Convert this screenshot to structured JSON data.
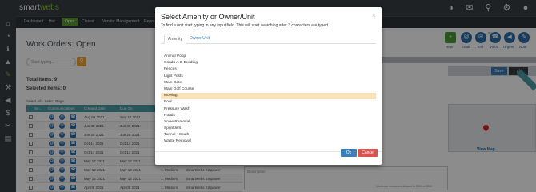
{
  "app": {
    "brand_main": "smart",
    "brand_accent": "webs"
  },
  "nav": {
    "tabs": [
      "Dashboard",
      "Hot",
      "Open",
      "Closed",
      "Vendor Management",
      "Reports"
    ],
    "active": "Open"
  },
  "page": {
    "title": "Work Orders: Open",
    "search_placeholder": "Start typing...",
    "total_items": "Total Items: 9",
    "selected_items": "Selected Items: 0",
    "select_links": "Select All · Select Page"
  },
  "table": {
    "columns": [
      "Se...",
      "Communications",
      "Created Date",
      "Due On"
    ],
    "rows": [
      {
        "created": "Aug 06 2021",
        "due": "Sep 10 2021",
        "priority": "",
        "vendor": ""
      },
      {
        "created": "Jun 30 2021",
        "due": "Jun 30 2021",
        "priority": "",
        "vendor": ""
      },
      {
        "created": "Jun 25 2021",
        "due": "Jun 25 2021",
        "priority": "",
        "vendor": ""
      },
      {
        "created": "Oct 14 2021",
        "due": "Oct 14 2021",
        "priority": "",
        "vendor": ""
      },
      {
        "created": "Oct 14 2021",
        "due": "Oct 14 2021",
        "priority": "",
        "vendor": ""
      },
      {
        "created": "May 12 2021",
        "due": "May 12 2021",
        "priority": "1. Medium",
        "vendor": "Smartwebs Empower"
      },
      {
        "created": "May 12 2021",
        "due": "May 12 2021",
        "priority": "1. Medium",
        "vendor": "Smartwebs Empower"
      },
      {
        "created": "May 12 2021",
        "due": "May 12 2021",
        "priority": "1. Medium",
        "vendor": "Smartwebs Empower"
      },
      {
        "created": "Apr 08 2021",
        "due": "Apr 08 2021",
        "priority": "1. Medium",
        "vendor": "Smartwebs Empower"
      }
    ]
  },
  "right_panel": {
    "sort_label": "Sort",
    "buttons": [
      "New",
      "Email",
      "Text",
      "Voice",
      "Urgent",
      "Note"
    ],
    "save": "Save",
    "view_map": "View Map",
    "description_label": "Description",
    "max_chars": "Maximum characters allowed is 2500 of 2500"
  },
  "modal": {
    "title": "Select Amenity or Owner/Unit",
    "hint": "To find a unit start typing in any input field. This will start searching after 3 characters are typed.",
    "tabs": [
      "Amenity",
      "Owner/Unit"
    ],
    "active_tab": "Amenity",
    "items": [
      "Animal Poop",
      "Condo A-D Building",
      "Fences",
      "Light Posts",
      "Main Gate",
      "Main Golf Course",
      "Mowing",
      "Pool",
      "Pressure Wash",
      "Roads",
      "Snow Removal",
      "Sprinklers",
      "Tunnel - South",
      "Waste Removal"
    ],
    "selected_item": "Mowing",
    "ok": "Ok",
    "cancel": "Cancel"
  },
  "colors": {
    "accent": "#5d9c34",
    "primary": "#3b7fb6",
    "danger": "#d9534f",
    "highlight": "#fbe3b9"
  }
}
